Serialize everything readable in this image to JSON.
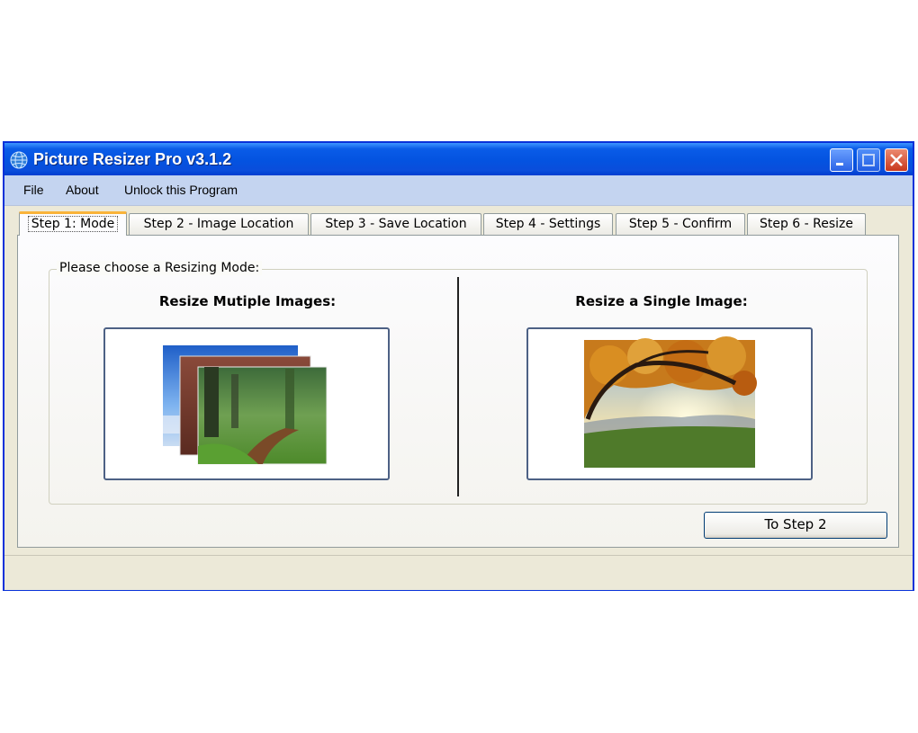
{
  "window": {
    "title": "Picture Resizer Pro v3.1.2",
    "title_color": "#0453e0",
    "menu": [
      "File",
      "About",
      "Unlock this Program"
    ]
  },
  "tabs": [
    {
      "label": "Step 1: Mode",
      "active": true
    },
    {
      "label": "Step 2 - Image Location",
      "active": false
    },
    {
      "label": "Step 3 - Save Location",
      "active": false
    },
    {
      "label": "Step 4 - Settings",
      "active": false
    },
    {
      "label": "Step 5 - Confirm",
      "active": false
    },
    {
      "label": "Step 6 - Resize",
      "active": false
    }
  ],
  "mode_panel": {
    "group_label": "Please choose a Resizing Mode:",
    "multiple_heading": "Resize Mutiple Images:",
    "single_heading": "Resize a Single Image:"
  },
  "next_button": "To Step 2",
  "icons": {
    "app": "globe-icon",
    "minimize": "minimize-icon",
    "maximize": "maximize-icon",
    "close": "close-icon",
    "multiple": "stacked-photos-icon",
    "single": "autumn-tree-photo"
  }
}
